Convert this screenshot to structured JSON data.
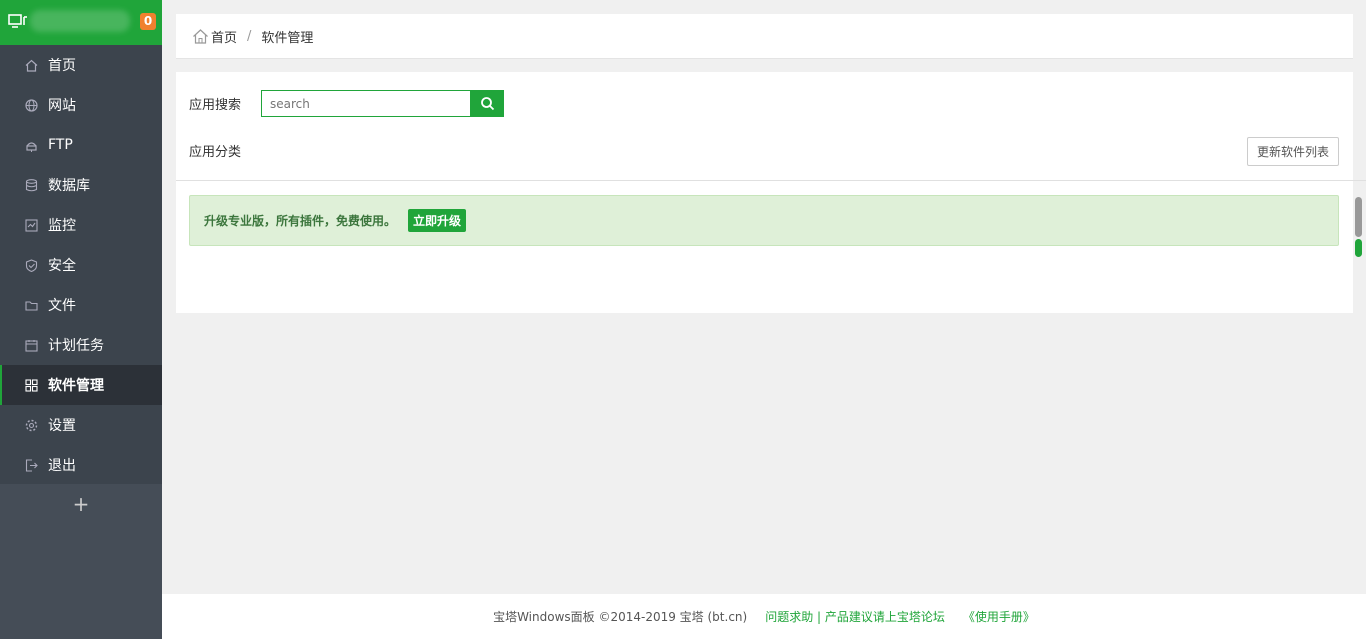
{
  "sidebar": {
    "badge": "0",
    "items": [
      {
        "label": "首页",
        "icon": "home-icon",
        "active": false
      },
      {
        "label": "网站",
        "icon": "globe-icon",
        "active": false
      },
      {
        "label": "FTP",
        "icon": "ftp-icon",
        "active": false
      },
      {
        "label": "数据库",
        "icon": "database-icon",
        "active": false
      },
      {
        "label": "监控",
        "icon": "monitor-icon",
        "active": false
      },
      {
        "label": "安全",
        "icon": "shield-icon",
        "active": false
      },
      {
        "label": "文件",
        "icon": "folder-icon",
        "active": false
      },
      {
        "label": "计划任务",
        "icon": "calendar-icon",
        "active": false
      },
      {
        "label": "软件管理",
        "icon": "grid-icon",
        "active": true
      },
      {
        "label": "设置",
        "icon": "gear-icon",
        "active": false
      },
      {
        "label": "退出",
        "icon": "logout-icon",
        "active": false
      }
    ],
    "add_label": "+"
  },
  "breadcrumb": {
    "home": "首页",
    "separator": "/",
    "current": "软件管理"
  },
  "main": {
    "search_label": "应用搜索",
    "search_placeholder": "search",
    "category_label": "应用分类",
    "update_button": "更新软件列表",
    "notice_text": "升级专业版，所有插件，免费使用。",
    "upgrade_button": "立即升级"
  },
  "footer": {
    "copyright": "宝塔Windows面板 ©2014-2019 宝塔 (bt.cn)",
    "help_link": "问题求助 | 产品建议请上宝塔论坛",
    "manual_link": "《使用手册》"
  },
  "colors": {
    "brand": "#20a53a",
    "sidebar_bg": "#3c444d",
    "badge": "#f0812f"
  }
}
